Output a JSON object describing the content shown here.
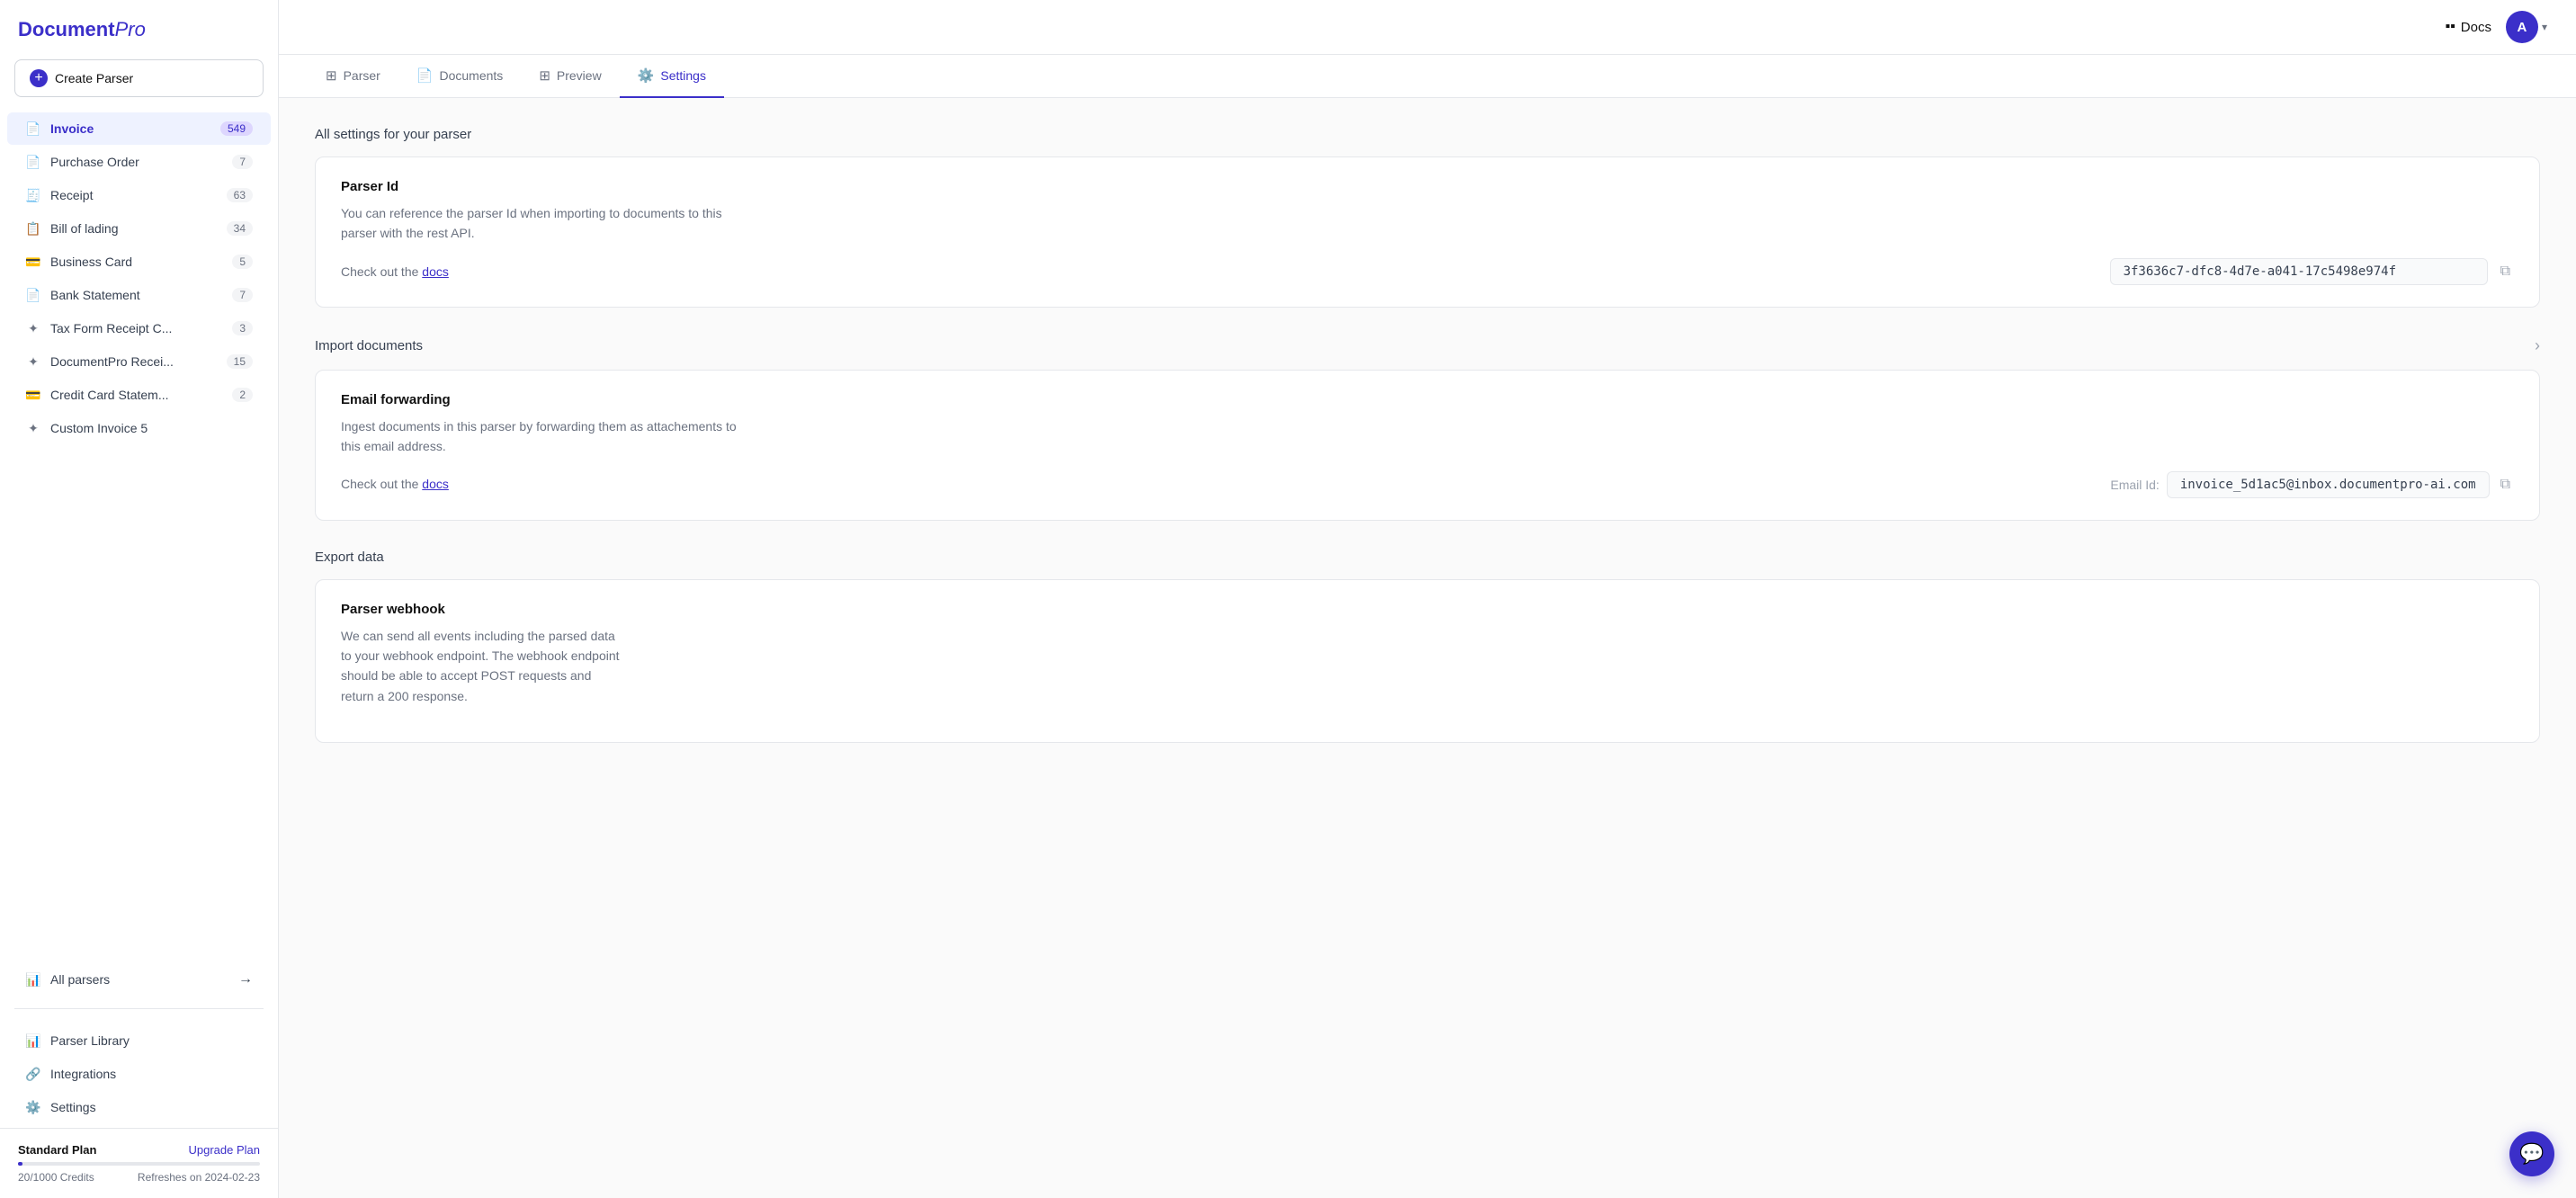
{
  "app": {
    "logo": "Document",
    "logo_pro": "Pro"
  },
  "sidebar": {
    "create_parser_label": "Create Parser",
    "nav_items": [
      {
        "id": "invoice",
        "label": "Invoice",
        "badge": "549",
        "active": true,
        "icon": "📄"
      },
      {
        "id": "purchase-order",
        "label": "Purchase Order",
        "badge": "7",
        "active": false,
        "icon": "📄"
      },
      {
        "id": "receipt",
        "label": "Receipt",
        "badge": "63",
        "active": false,
        "icon": "🧾"
      },
      {
        "id": "bill-of-lading",
        "label": "Bill of lading",
        "badge": "34",
        "active": false,
        "icon": "📋"
      },
      {
        "id": "business-card",
        "label": "Business Card",
        "badge": "5",
        "active": false,
        "icon": "💳"
      },
      {
        "id": "bank-statement",
        "label": "Bank Statement",
        "badge": "7",
        "active": false,
        "icon": "📄"
      },
      {
        "id": "tax-form",
        "label": "Tax Form Receipt C...",
        "badge": "3",
        "active": false,
        "icon": "✦"
      },
      {
        "id": "documentpro-recei",
        "label": "DocumentPro Recei...",
        "badge": "15",
        "active": false,
        "icon": "✦"
      },
      {
        "id": "credit-card",
        "label": "Credit Card Statem...",
        "badge": "2",
        "active": false,
        "icon": "💳"
      },
      {
        "id": "custom-invoice-5",
        "label": "Custom Invoice 5",
        "badge": "",
        "active": false,
        "icon": "✦"
      }
    ],
    "all_parsers_label": "All parsers",
    "bottom_items": [
      {
        "id": "parser-library",
        "label": "Parser Library",
        "icon": "📊"
      },
      {
        "id": "integrations",
        "label": "Integrations",
        "icon": "🔗"
      },
      {
        "id": "settings",
        "label": "Settings",
        "icon": "⚙️"
      }
    ],
    "plan": {
      "name": "Standard Plan",
      "upgrade_label": "Upgrade Plan",
      "credits_used": "20/1000 Credits",
      "refresh_date": "Refreshes on 2024-02-23",
      "progress_pct": 2
    }
  },
  "topbar": {
    "docs_label": "Docs",
    "avatar_letter": "A"
  },
  "tabs": [
    {
      "id": "parser",
      "label": "Parser",
      "active": false,
      "icon": "⊞"
    },
    {
      "id": "documents",
      "label": "Documents",
      "active": false,
      "icon": "📄"
    },
    {
      "id": "preview",
      "label": "Preview",
      "active": false,
      "icon": "⊞"
    },
    {
      "id": "settings",
      "label": "Settings",
      "active": true,
      "icon": "⚙️"
    }
  ],
  "content": {
    "page_title": "All settings for your parser",
    "parser_id_section": {
      "title": "Parser Id",
      "desc_line1": "You can reference the parser Id when importing to documents to this",
      "desc_line2": "parser with the rest API.",
      "check_out_text": "Check out the ",
      "docs_link": "docs",
      "parser_id_value": "3f3636c7-dfc8-4d7e-a041-17c5498e974f"
    },
    "import_section": {
      "title": "Import documents",
      "email_forwarding_card": {
        "title": "Email forwarding",
        "desc_line1": "Ingest documents in this parser by forwarding them as attachements to",
        "desc_line2": "this email address.",
        "check_out_text": "Check out the ",
        "docs_link": "docs",
        "email_id_label": "Email Id:",
        "email_id_value": "invoice_5d1ac5@inbox.documentpro-ai.com"
      }
    },
    "export_section": {
      "title": "Export data",
      "webhook_card": {
        "title": "Parser webhook",
        "desc_line1": "We can send all events including the parsed data",
        "desc_line2": "to your webhook endpoint. The webhook endpoint",
        "desc_line3": "should be able to accept POST requests and",
        "desc_line4": "return a 200 response."
      }
    }
  }
}
